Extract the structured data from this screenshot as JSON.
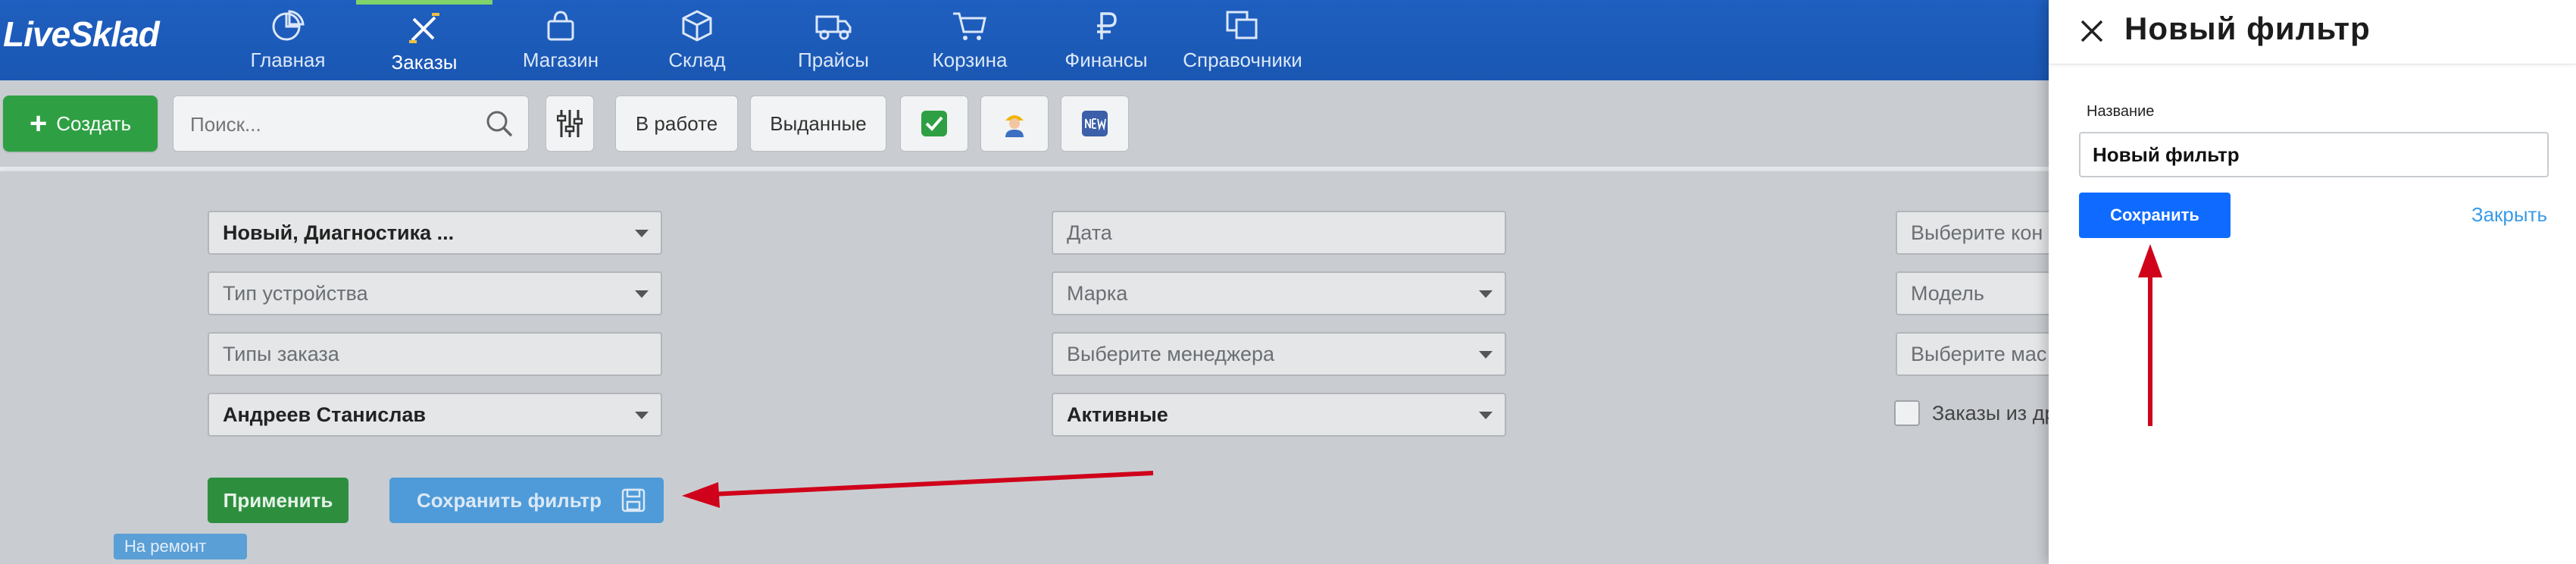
{
  "app": {
    "logo": "LiveSklad"
  },
  "nav": {
    "items": [
      {
        "label": "Главная",
        "icon": "pie-chart-icon"
      },
      {
        "label": "Заказы",
        "icon": "tools-icon",
        "active": true
      },
      {
        "label": "Магазин",
        "icon": "shopping-bag-icon"
      },
      {
        "label": "Склад",
        "icon": "box-icon"
      },
      {
        "label": "Прайсы",
        "icon": "truck-icon"
      },
      {
        "label": "Корзина",
        "icon": "cart-icon"
      },
      {
        "label": "Финансы",
        "icon": "ruble-icon"
      },
      {
        "label": "Справочники",
        "icon": "copy-icon"
      }
    ]
  },
  "toolbar": {
    "create_label": "Создать",
    "search_placeholder": "Поиск...",
    "in_work_label": "В работе",
    "issued_label": "Выданные"
  },
  "filters": {
    "status": "Новый, Диагностика ...",
    "device_type": "Тип устройства",
    "order_types": "Типы заказа",
    "employee": "Андреев Станислав",
    "date": "Дата",
    "brand": "Марка",
    "manager": "Выберите менеджера",
    "active": "Активные",
    "contractor": "Выберите кон",
    "model": "Модель",
    "master": "Выберите мас",
    "other_orders_label": "Заказы из др",
    "apply_label": "Применить",
    "save_filter_label": "Сохранить фильтр"
  },
  "background_row": {
    "status_badge": "На ремонт"
  },
  "drawer": {
    "title": "Новый фильтр",
    "name_label": "Название",
    "name_value": "Новый фильтр",
    "save_label": "Сохранить",
    "close_label": "Закрыть"
  },
  "colors": {
    "nav_bg": "#1f5fbf",
    "create_green": "#2ea043",
    "save_blue": "#0f6bff",
    "link_blue": "#3a9be8",
    "arrow_red": "#d0021b"
  }
}
